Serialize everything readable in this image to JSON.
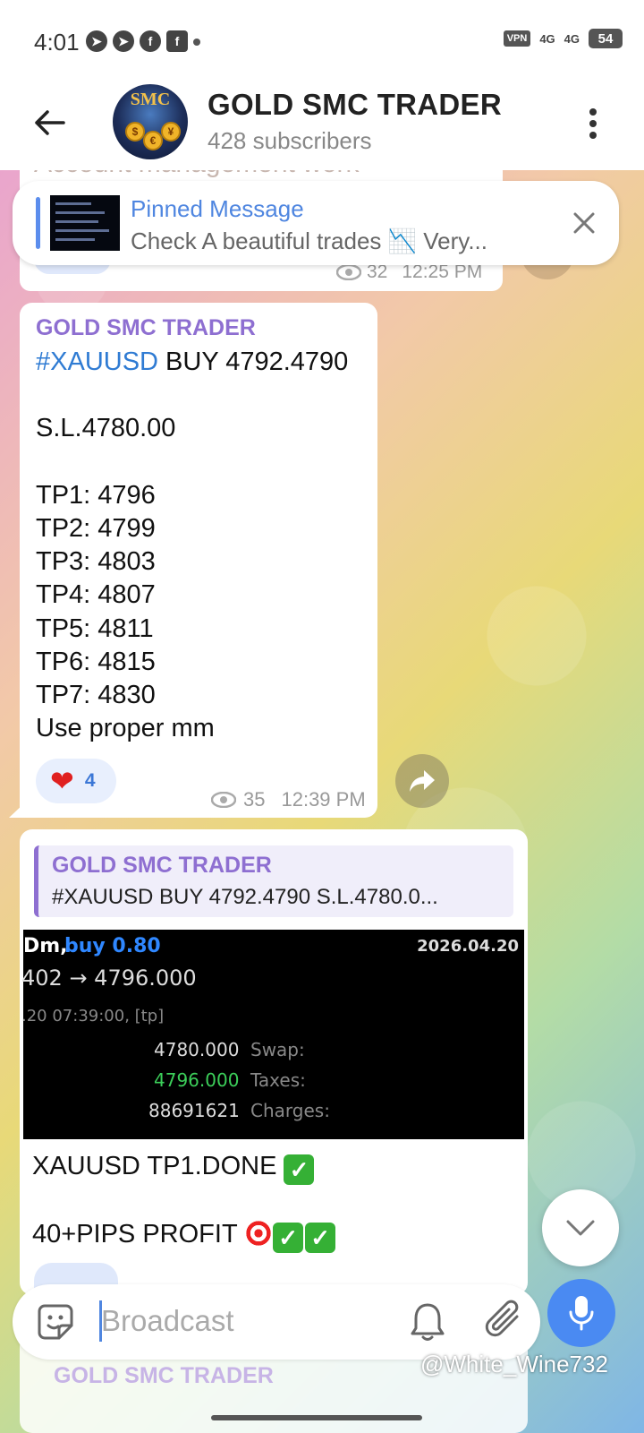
{
  "status_bar": {
    "time": "4:01",
    "vpn": "VPN",
    "signal1": "4G",
    "signal2": "4G",
    "battery": "54"
  },
  "header": {
    "channel_name": "GOLD SMC TRADER",
    "subscribers": "428 subscribers",
    "avatar_text": "SMC"
  },
  "previous_message": {
    "text_partial": "Account management work",
    "views": "32",
    "time": "12:25 PM"
  },
  "pinned": {
    "title": "Pinned Message",
    "text": "Check A beautiful trades 📉 Very..."
  },
  "post": {
    "author": "GOLD SMC TRADER",
    "hashtag": "#XAUUSD",
    "line1_rest": " BUY 4792.4790",
    "stop_loss": "S.L.4780.00",
    "tps": [
      "TP1: 4796",
      "TP2: 4799",
      "TP3: 4803",
      "TP4: 4807",
      "TP5: 4811",
      "TP6: 4815",
      "TP7: 4830"
    ],
    "footer": "Use proper mm",
    "reaction_count": "4",
    "views": "35",
    "time": "12:39 PM"
  },
  "reply": {
    "quote_author": "GOLD SMC TRADER",
    "quote_text": "#XAUUSD BUY 4792.4790  S.L.4780.0...",
    "screenshot": {
      "prefix": "Dm,",
      "order": "buy 0.80",
      "date": "2026.04.20",
      "price_line": "402 → 4796.000",
      "time_line": ".20 07:39:00, [tp]",
      "sl_value": "4780.000",
      "sl_label": "Swap:",
      "tp_value": "4796.000",
      "tp_label": "Taxes:",
      "id_value": "88691621",
      "id_label": "Charges:"
    },
    "line1": "XAUUSD TP1.DONE",
    "line2": "40+PIPS PROFIT"
  },
  "bottom_peek": {
    "author": "GOLD SMC TRADER"
  },
  "input": {
    "placeholder": "Broadcast"
  },
  "watermark": "@White_Wine732",
  "colors": {
    "accent": "#4f86e0",
    "author": "#8e6fd1",
    "mic": "#4a8af2"
  }
}
